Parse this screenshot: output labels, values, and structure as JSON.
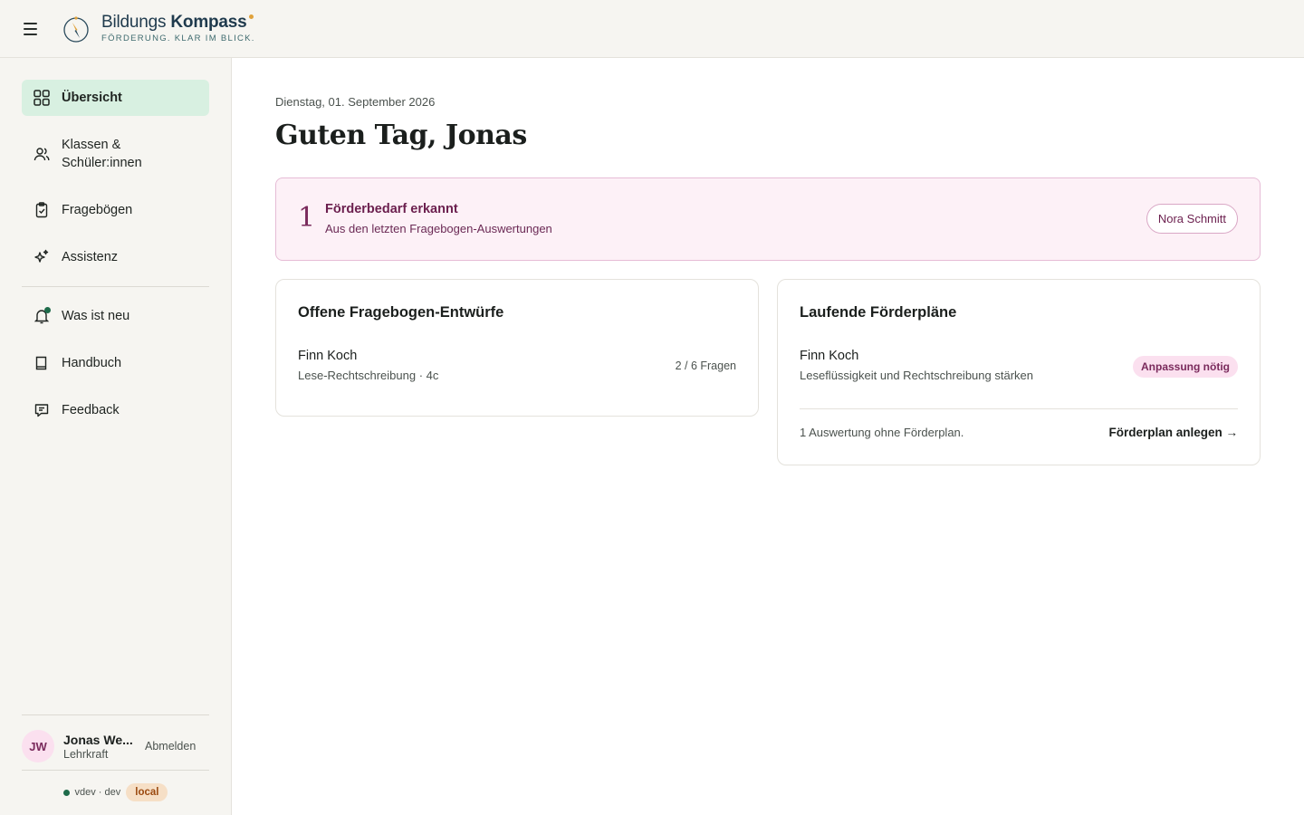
{
  "header": {
    "brand_first": "Bildungs",
    "brand_second": "Kompass",
    "tagline": "FÖRDERUNG. KLAR IM BLICK."
  },
  "sidebar": {
    "items": [
      {
        "label": "Übersicht",
        "icon": "grid-icon",
        "active": true
      },
      {
        "label": "Klassen & Schüler:innen",
        "icon": "users-icon"
      },
      {
        "label": "Fragebögen",
        "icon": "clipboard-icon"
      },
      {
        "label": "Assistenz",
        "icon": "sparkle-icon"
      },
      {
        "label": "Was ist neu",
        "icon": "bell-icon"
      },
      {
        "label": "Handbuch",
        "icon": "book-icon"
      },
      {
        "label": "Feedback",
        "icon": "chat-icon"
      }
    ],
    "user": {
      "initials": "JW",
      "name": "Jonas We...",
      "role": "Lehrkraft",
      "logout": "Abmelden"
    },
    "env": {
      "version": "vdev · dev",
      "badge": "local"
    }
  },
  "main": {
    "date": "Dienstag, 01. September 2026",
    "greeting": "Guten Tag, Jonas",
    "alert": {
      "count": "1",
      "title": "Förderbedarf erkannt",
      "subtitle": "Aus den letzten Fragebogen-Auswertungen",
      "student_button": "Nora Schmitt"
    },
    "drafts": {
      "title": "Offene Fragebogen-Entwürfe",
      "rows": [
        {
          "name": "Finn Koch",
          "sub": "Lese-Rechtschreibung · 4c",
          "meta": "2 / 6 Fragen"
        }
      ]
    },
    "plans": {
      "title": "Laufende Förderpläne",
      "rows": [
        {
          "name": "Finn Koch",
          "sub": "Leseflüssigkeit und Rechtschreibung stärken",
          "badge": "Anpassung nötig"
        }
      ],
      "footer_text": "1 Auswertung ohne Förderplan.",
      "footer_link": "Förderplan anlegen →"
    }
  },
  "colors": {
    "accent_green": "#d8f0e1",
    "alert_bg": "#fdf1f7",
    "alert_text": "#6b1f4e",
    "env_badge": "#f6dfc6"
  }
}
